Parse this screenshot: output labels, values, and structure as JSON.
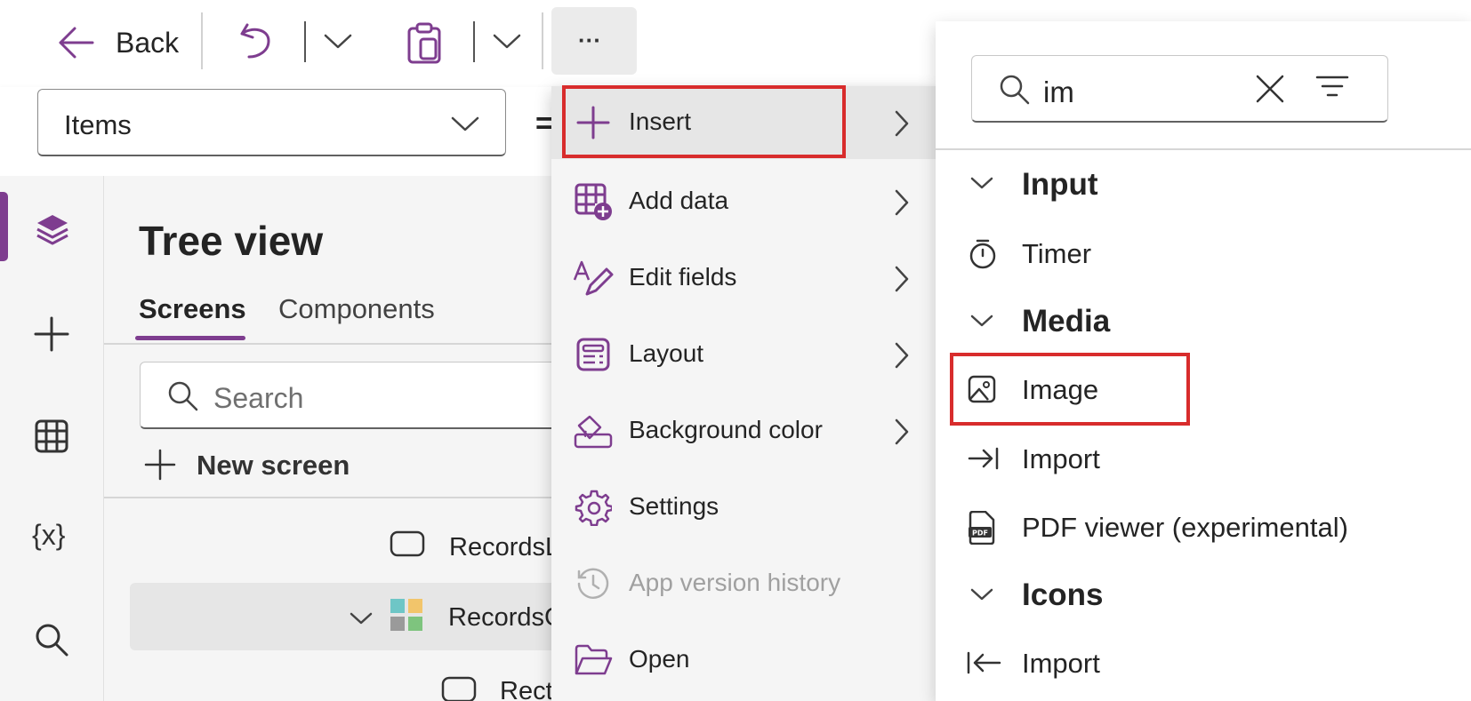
{
  "toolbar": {
    "back_label": "Back",
    "more_label": "···"
  },
  "formula": {
    "property": "Items",
    "equals": "="
  },
  "tree": {
    "title": "Tree view",
    "tabs": [
      "Screens",
      "Components"
    ],
    "search_placeholder": "Search",
    "new_screen_label": "New screen",
    "items": [
      {
        "label": "RecordsL"
      },
      {
        "label": "RecordsG"
      },
      {
        "label": "Recta"
      }
    ]
  },
  "menu": {
    "items": [
      {
        "label": "Insert",
        "has_submenu": true
      },
      {
        "label": "Add data",
        "has_submenu": true
      },
      {
        "label": "Edit fields",
        "has_submenu": true
      },
      {
        "label": "Layout",
        "has_submenu": true
      },
      {
        "label": "Background color",
        "has_submenu": true
      },
      {
        "label": "Settings",
        "has_submenu": false
      },
      {
        "label": "App version history",
        "has_submenu": false,
        "disabled": true
      },
      {
        "label": "Open",
        "has_submenu": false
      }
    ]
  },
  "flyout": {
    "search_value": "im",
    "categories": [
      {
        "name": "Input",
        "items": [
          "Timer"
        ]
      },
      {
        "name": "Media",
        "items": [
          "Image",
          "Import",
          "PDF viewer (experimental)"
        ]
      },
      {
        "name": "Icons",
        "items": [
          "Import"
        ]
      }
    ]
  },
  "colors": {
    "accent": "#7e3d8f",
    "highlight": "#d82c2c"
  }
}
